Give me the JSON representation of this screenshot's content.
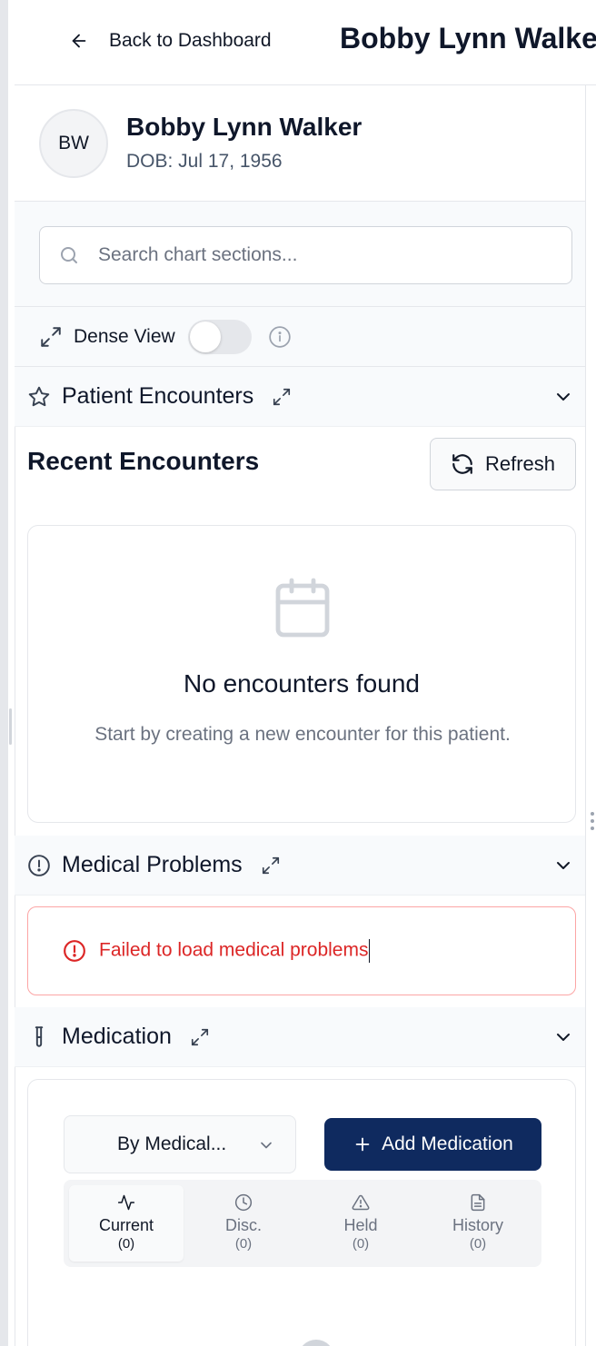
{
  "header": {
    "back_label": "Back to Dashboard",
    "title": "Bobby Lynn Walker"
  },
  "patient": {
    "initials": "BW",
    "name": "Bobby Lynn Walker",
    "dob": "DOB: Jul 17, 1956"
  },
  "search": {
    "placeholder": "Search chart sections..."
  },
  "dense_view": {
    "label": "Dense View",
    "enabled": false
  },
  "sections": {
    "encounters": {
      "title": "Patient Encounters",
      "recent_title": "Recent Encounters",
      "refresh_label": "Refresh",
      "empty_title": "No encounters found",
      "empty_text": "Start by creating a new encounter for this patient."
    },
    "problems": {
      "title": "Medical Problems",
      "error_text": "Failed to load medical problems"
    },
    "medication": {
      "title": "Medication",
      "group_select": "By Medical...",
      "add_label": "Add Medication",
      "tabs": [
        {
          "label": "Current",
          "count": "(0)",
          "icon": "activity-icon"
        },
        {
          "label": "Disc.",
          "count": "(0)",
          "icon": "clock-icon"
        },
        {
          "label": "Held",
          "count": "(0)",
          "icon": "warning-icon"
        },
        {
          "label": "History",
          "count": "(0)",
          "icon": "document-icon"
        }
      ]
    }
  },
  "colors": {
    "primary": "#0f2a5f",
    "error": "#dc2626",
    "section_bg": "#f8fafc"
  }
}
